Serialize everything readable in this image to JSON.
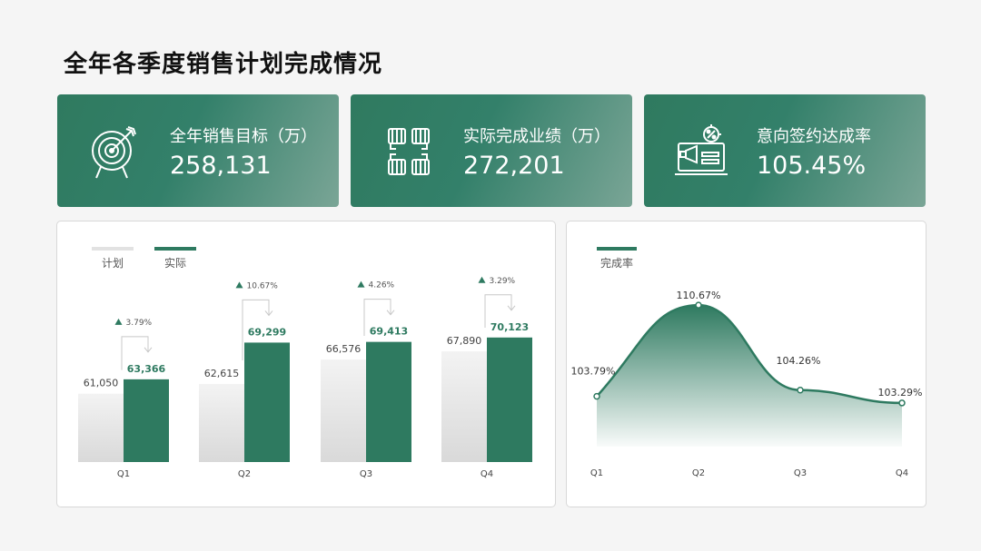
{
  "page_title": "全年各季度销售计划完成情况",
  "kpis": [
    {
      "label": "全年销售目标（万）",
      "value": "258,131",
      "icon": "target-icon"
    },
    {
      "label": "实际完成业绩（万）",
      "value": "272,201",
      "icon": "fists-icon"
    },
    {
      "label": "意向签约达成率",
      "value": "105.45%",
      "icon": "laptop-megaphone-icon"
    }
  ],
  "colors": {
    "accent": "#2e7a60",
    "plan": "#e4e4e4",
    "arrow": "#c8c8c8"
  },
  "chart_data": [
    {
      "type": "bar",
      "categories": [
        "Q1",
        "Q2",
        "Q3",
        "Q4"
      ],
      "series": [
        {
          "name": "计划",
          "values": [
            61050,
            62615,
            66576,
            67890
          ]
        },
        {
          "name": "实际",
          "values": [
            63366,
            69299,
            69413,
            70123
          ]
        }
      ],
      "value_labels": {
        "计划": [
          "61,050",
          "62,615",
          "66,576",
          "67,890"
        ],
        "实际": [
          "63,366",
          "69,299",
          "69,413",
          "70,123"
        ]
      },
      "growth_labels": [
        "3.79%",
        "10.67%",
        "4.26%",
        "3.29%"
      ],
      "ylim": [
        50000,
        72000
      ],
      "legend": "top-left",
      "grid": false
    },
    {
      "type": "area",
      "categories": [
        "Q1",
        "Q2",
        "Q3",
        "Q4"
      ],
      "series": [
        {
          "name": "完成率",
          "values": [
            103.79,
            110.67,
            104.26,
            103.29
          ]
        }
      ],
      "value_labels": [
        "103.79%",
        "110.67%",
        "104.26%",
        "103.29%"
      ],
      "ylim": [
        100,
        111.5
      ],
      "legend": "top-left",
      "grid": false
    }
  ]
}
